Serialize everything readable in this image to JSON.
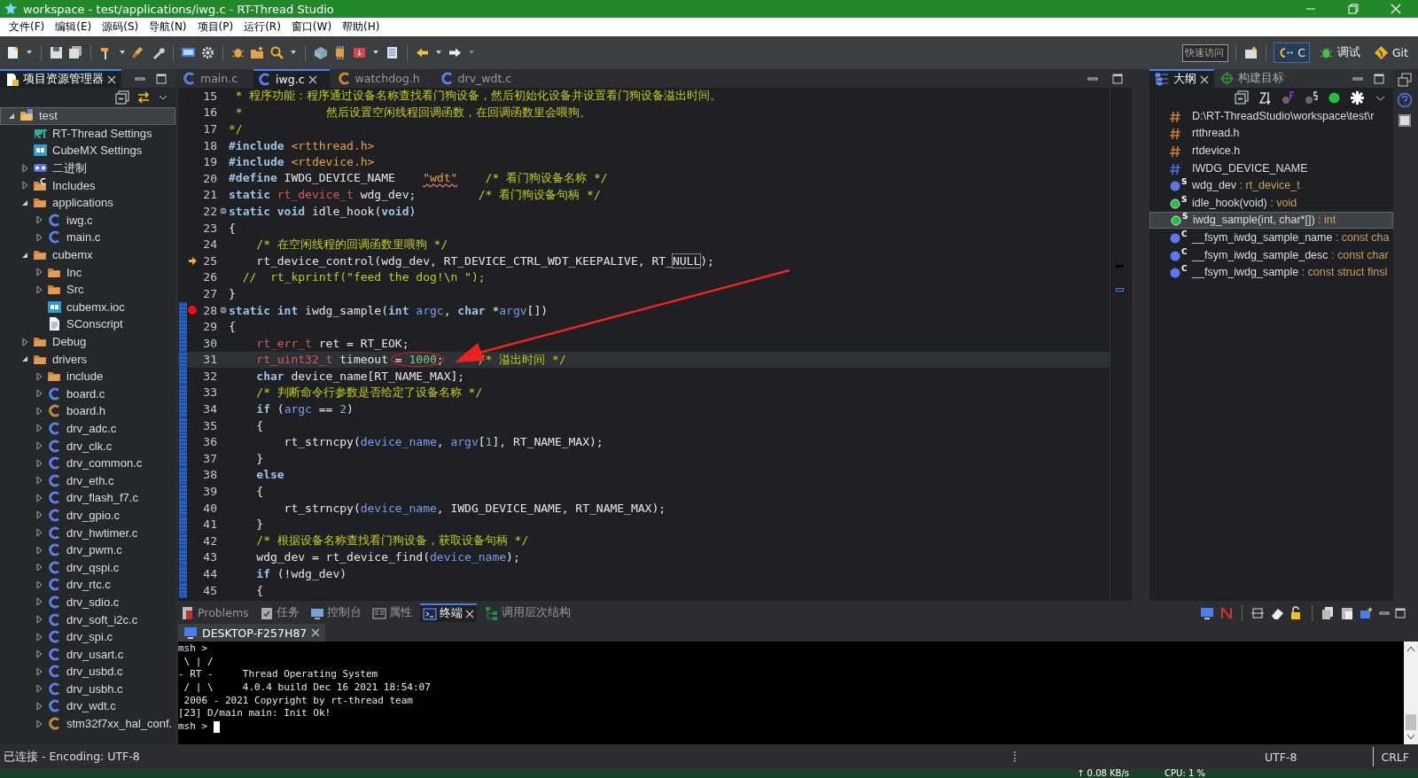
{
  "window": {
    "title": "workspace - test/applications/iwg.c - RT-Thread Studio"
  },
  "menu": [
    "文件(F)",
    "编辑(E)",
    "源码(S)",
    "导航(N)",
    "项目(P)",
    "运行(R)",
    "窗口(W)",
    "帮助(H)"
  ],
  "toolbar": {
    "quick_access": {
      "placeholder": "快速访问"
    },
    "perspectives": [
      {
        "label": "C",
        "kind": "cpp",
        "selected": true
      },
      {
        "label": "调试",
        "kind": "debug",
        "selected": false
      },
      {
        "label": "Git",
        "kind": "git",
        "selected": false
      }
    ]
  },
  "explorer": {
    "title": "项目资源管理器",
    "tree": [
      {
        "label": "test",
        "kind": "project",
        "expanded": true,
        "selected": true,
        "children": [
          {
            "label": "RT-Thread Settings",
            "kind": "rt",
            "selected": false
          },
          {
            "label": "CubeMX Settings",
            "kind": "mx",
            "selected": false
          },
          {
            "label": "二进制",
            "kind": "binary",
            "expanded": false,
            "selected": false
          },
          {
            "label": "Includes",
            "kind": "includes",
            "expanded": false,
            "selected": false
          },
          {
            "label": "applications",
            "kind": "folder",
            "expanded": true,
            "selected": false,
            "children": [
              {
                "label": "iwg.c",
                "kind": "c",
                "expanded": false,
                "selected": false
              },
              {
                "label": "main.c",
                "kind": "c",
                "expanded": false,
                "selected": false
              }
            ]
          },
          {
            "label": "cubemx",
            "kind": "folder",
            "expanded": true,
            "selected": false,
            "children": [
              {
                "label": "Inc",
                "kind": "folder",
                "expanded": false,
                "selected": false
              },
              {
                "label": "Src",
                "kind": "folder",
                "expanded": false,
                "selected": false
              },
              {
                "label": "cubemx.ioc",
                "kind": "mx",
                "selected": false
              },
              {
                "label": "SConscript",
                "kind": "file",
                "selected": false
              }
            ]
          },
          {
            "label": "Debug",
            "kind": "folder",
            "expanded": false,
            "selected": false
          },
          {
            "label": "drivers",
            "kind": "folder",
            "expanded": true,
            "selected": false,
            "children": [
              {
                "label": "include",
                "kind": "folder",
                "expanded": false,
                "selected": false
              },
              {
                "label": "board.c",
                "kind": "c",
                "expanded": false,
                "selected": false
              },
              {
                "label": "board.h",
                "kind": "h",
                "expanded": false,
                "selected": false
              },
              {
                "label": "drv_adc.c",
                "kind": "c",
                "expanded": false,
                "selected": false
              },
              {
                "label": "drv_clk.c",
                "kind": "c",
                "expanded": false,
                "selected": false
              },
              {
                "label": "drv_common.c",
                "kind": "c",
                "expanded": false,
                "selected": false
              },
              {
                "label": "drv_eth.c",
                "kind": "c",
                "expanded": false,
                "selected": false
              },
              {
                "label": "drv_flash_f7.c",
                "kind": "c",
                "expanded": false,
                "selected": false
              },
              {
                "label": "drv_gpio.c",
                "kind": "c",
                "expanded": false,
                "selected": false
              },
              {
                "label": "drv_hwtimer.c",
                "kind": "c",
                "expanded": false,
                "selected": false
              },
              {
                "label": "drv_pwm.c",
                "kind": "c",
                "expanded": false,
                "selected": false
              },
              {
                "label": "drv_qspi.c",
                "kind": "c",
                "expanded": false,
                "selected": false
              },
              {
                "label": "drv_rtc.c",
                "kind": "c",
                "expanded": false,
                "selected": false
              },
              {
                "label": "drv_sdio.c",
                "kind": "c",
                "expanded": false,
                "selected": false
              },
              {
                "label": "drv_soft_i2c.c",
                "kind": "c",
                "expanded": false,
                "selected": false
              },
              {
                "label": "drv_spi.c",
                "kind": "c",
                "expanded": false,
                "selected": false
              },
              {
                "label": "drv_usart.c",
                "kind": "c",
                "expanded": false,
                "selected": false
              },
              {
                "label": "drv_usbd.c",
                "kind": "c",
                "expanded": false,
                "selected": false
              },
              {
                "label": "drv_usbh.c",
                "kind": "c",
                "expanded": false,
                "selected": false
              },
              {
                "label": "drv_wdt.c",
                "kind": "c",
                "expanded": false,
                "selected": false
              },
              {
                "label": "stm32f7xx_hal_conf.",
                "kind": "h",
                "expanded": false,
                "selected": false
              }
            ]
          }
        ]
      }
    ]
  },
  "editor": {
    "tabs": [
      {
        "label": "main.c",
        "kind": "c",
        "selected": false
      },
      {
        "label": "iwg.c",
        "kind": "c",
        "selected": true
      },
      {
        "label": "watchdog.h",
        "kind": "h",
        "selected": false
      },
      {
        "label": "drv_wdt.c",
        "kind": "c",
        "selected": false
      }
    ],
    "lines": [
      {
        "number": "15",
        "code": [
          {
            "kind": "cm",
            "text": " * 程序功能：程序通过设备名称查找看门狗设备，然后初始化设备并设置看门狗设备溢出时间。"
          }
        ]
      },
      {
        "number": "16",
        "code": [
          {
            "kind": "cm",
            "text": " *            然后设置空闲线程回调函数，在回调函数里会喂狗。"
          }
        ]
      },
      {
        "number": "17",
        "code": [
          {
            "kind": "cm",
            "text": "*/"
          }
        ]
      },
      {
        "number": "18",
        "code": [
          {
            "kind": "kw",
            "text": "#include"
          },
          {
            "kind": "in",
            "text": " <rtthread.h>"
          }
        ]
      },
      {
        "number": "19",
        "code": [
          {
            "kind": "kw",
            "text": "#include"
          },
          {
            "kind": "in",
            "text": " <rtdevice.h>"
          }
        ]
      },
      {
        "number": "20",
        "code": [
          {
            "kind": "kw",
            "text": "#define"
          },
          {
            "kind": "p",
            "text": " IWDG_DEVICE_NAME    "
          },
          {
            "kind": "stw",
            "text": "\"wdt\""
          },
          {
            "kind": "cm",
            "text": "    /* 看门狗设备名称 */"
          }
        ]
      },
      {
        "number": "21",
        "code": [
          {
            "kind": "kw",
            "text": "static"
          },
          {
            "kind": "ty",
            "text": " rt_device_t"
          },
          {
            "kind": "p",
            "text": " wdg_dev;         "
          },
          {
            "kind": "cm",
            "text": "/* 看门狗设备句柄 */"
          }
        ]
      },
      {
        "number": "22",
        "fold": true,
        "code": [
          {
            "kind": "kw",
            "text": "static"
          },
          {
            "kind": "kw",
            "text": " void"
          },
          {
            "kind": "p",
            "text": " idle_hook("
          },
          {
            "kind": "kw",
            "text": "void"
          },
          {
            "kind": "p",
            "text": ")"
          }
        ]
      },
      {
        "number": "23",
        "code": [
          {
            "kind": "p",
            "text": "{"
          }
        ]
      },
      {
        "number": "24",
        "code": [
          {
            "kind": "cm",
            "text": "    /* 在空闲线程的回调函数里喂狗 */"
          }
        ]
      },
      {
        "number": "25",
        "instruction_pointer": true,
        "code": [
          {
            "kind": "p",
            "text": "    rt_device_control(wdg_dev, RT_DEVICE_CTRL_WDT_KEEPALIVE, RT_"
          },
          {
            "kind": "oc",
            "text": "NULL"
          },
          {
            "kind": "p",
            "text": ");"
          }
        ]
      },
      {
        "number": "26",
        "code": [
          {
            "kind": "cm",
            "text": "  //  rt_kprintf(\"feed the dog!\\n \");"
          }
        ]
      },
      {
        "number": "27",
        "code": [
          {
            "kind": "p",
            "text": "}"
          }
        ]
      },
      {
        "number": "28",
        "fold": true,
        "changed": true,
        "breakpoint": true,
        "code": [
          {
            "kind": "kw",
            "text": "static"
          },
          {
            "kind": "kw",
            "text": " int"
          },
          {
            "kind": "p",
            "text": " iwdg_sample("
          },
          {
            "kind": "kw",
            "text": "int"
          },
          {
            "kind": "pa",
            "text": " argc"
          },
          {
            "kind": "p",
            "text": ", "
          },
          {
            "kind": "kw",
            "text": "char"
          },
          {
            "kind": "p",
            "text": " *"
          },
          {
            "kind": "pa",
            "text": "argv"
          },
          {
            "kind": "p",
            "text": "[])"
          }
        ]
      },
      {
        "number": "29",
        "changed": true,
        "code": [
          {
            "kind": "p",
            "text": "{"
          }
        ]
      },
      {
        "number": "30",
        "changed": true,
        "code": [
          {
            "kind": "ty",
            "text": "    rt_err_t"
          },
          {
            "kind": "p",
            "text": " ret = RT_EOK;"
          }
        ]
      },
      {
        "number": "31",
        "current": true,
        "changed": true,
        "circled": true,
        "code": [
          {
            "kind": "ty",
            "text": "    rt_uint32_t"
          },
          {
            "kind": "p",
            "text": " timeout = "
          },
          {
            "kind": "nu",
            "text": "1000"
          },
          {
            "kind": "p",
            "text": ";     "
          },
          {
            "kind": "cm",
            "text": "/* 溢出时间 */"
          }
        ]
      },
      {
        "number": "32",
        "changed": true,
        "code": [
          {
            "kind": "kw",
            "text": "    char"
          },
          {
            "kind": "p",
            "text": " device_name[RT_NAME_MAX];"
          }
        ]
      },
      {
        "number": "33",
        "changed": true,
        "code": [
          {
            "kind": "cm",
            "text": "    /* 判断命令行参数是否给定了设备名称 */"
          }
        ]
      },
      {
        "number": "34",
        "changed": true,
        "code": [
          {
            "kind": "kw",
            "text": "    if"
          },
          {
            "kind": "p",
            "text": " ("
          },
          {
            "kind": "pa",
            "text": "argc"
          },
          {
            "kind": "p",
            "text": " == "
          },
          {
            "kind": "nu",
            "text": "2"
          },
          {
            "kind": "p",
            "text": ")"
          }
        ]
      },
      {
        "number": "35",
        "changed": true,
        "code": [
          {
            "kind": "p",
            "text": "    {"
          }
        ]
      },
      {
        "number": "36",
        "changed": true,
        "code": [
          {
            "kind": "p",
            "text": "        rt_strncpy("
          },
          {
            "kind": "pa",
            "text": "device_name"
          },
          {
            "kind": "p",
            "text": ", "
          },
          {
            "kind": "pa",
            "text": "argv"
          },
          {
            "kind": "p",
            "text": "["
          },
          {
            "kind": "nu",
            "text": "1"
          },
          {
            "kind": "p",
            "text": "], RT_NAME_MAX);"
          }
        ]
      },
      {
        "number": "37",
        "changed": true,
        "code": [
          {
            "kind": "p",
            "text": "    }"
          }
        ]
      },
      {
        "number": "38",
        "changed": true,
        "code": [
          {
            "kind": "kw",
            "text": "    else"
          }
        ]
      },
      {
        "number": "39",
        "changed": true,
        "code": [
          {
            "kind": "p",
            "text": "    {"
          }
        ]
      },
      {
        "number": "40",
        "changed": true,
        "code": [
          {
            "kind": "p",
            "text": "        rt_strncpy("
          },
          {
            "kind": "pa",
            "text": "device_name"
          },
          {
            "kind": "p",
            "text": ", IWDG_DEVICE_NAME, RT_NAME_MAX);"
          }
        ]
      },
      {
        "number": "41",
        "changed": true,
        "code": [
          {
            "kind": "p",
            "text": "    }"
          }
        ]
      },
      {
        "number": "42",
        "changed": true,
        "code": [
          {
            "kind": "cm",
            "text": "    /* 根据设备名称查找看门狗设备，获取设备句柄 */"
          }
        ]
      },
      {
        "number": "43",
        "changed": true,
        "code": [
          {
            "kind": "p",
            "text": "    wdg_dev = rt_device_find("
          },
          {
            "kind": "pa",
            "text": "device_name"
          },
          {
            "kind": "p",
            "text": ");"
          }
        ]
      },
      {
        "number": "44",
        "changed": true,
        "code": [
          {
            "kind": "kw",
            "text": "    if"
          },
          {
            "kind": "p",
            "text": " (!wdg_dev)"
          }
        ]
      },
      {
        "number": "45",
        "changed": true,
        "code": [
          {
            "kind": "p",
            "text": "    {"
          }
        ]
      }
    ]
  },
  "outline": {
    "tabs": [
      {
        "label": "大纲",
        "kind": "outline",
        "selected": true
      },
      {
        "label": "构建目标",
        "kind": "target",
        "selected": false
      }
    ],
    "items": [
      {
        "kind": "include",
        "name": "D:\\RT-ThreadStudio\\workspace\\test\\r",
        "selected": false
      },
      {
        "kind": "include",
        "name": "rtthread.h",
        "selected": false
      },
      {
        "kind": "include",
        "name": "rtdevice.h",
        "selected": false
      },
      {
        "kind": "macro",
        "name": "IWDG_DEVICE_NAME",
        "selected": false
      },
      {
        "kind": "var",
        "badge": "S",
        "name": "wdg_dev",
        "type": " : rt_device_t",
        "selected": false
      },
      {
        "kind": "func",
        "badge": "S",
        "name": "idle_hook(void)",
        "type": " : void",
        "selected": false
      },
      {
        "kind": "func",
        "badge": "S",
        "name": "iwdg_sample(int, char*[])",
        "type": " : int",
        "selected": true
      },
      {
        "kind": "var",
        "badge": "C",
        "name": "__fsym_iwdg_sample_name",
        "type": " : const cha",
        "selected": false
      },
      {
        "kind": "var",
        "badge": "C",
        "name": "__fsym_iwdg_sample_desc",
        "type": " : const char",
        "selected": false
      },
      {
        "kind": "var",
        "badge": "C",
        "name": "__fsym_iwdg_sample",
        "type": " : const struct finsl",
        "selected": false
      }
    ]
  },
  "bottom_panel": {
    "tabs": [
      {
        "label": "Problems",
        "kind": "problems",
        "selected": false
      },
      {
        "label": "任务",
        "kind": "tasks",
        "selected": false
      },
      {
        "label": "控制台",
        "kind": "console",
        "selected": false
      },
      {
        "label": "属性",
        "kind": "properties",
        "selected": false
      },
      {
        "label": "终端",
        "kind": "terminal",
        "selected": true
      },
      {
        "label": "调用层次结构",
        "kind": "hierarchy",
        "selected": false
      }
    ],
    "terminal": {
      "tab": "DESKTOP-F257H87",
      "lines": [
        "msh >",
        " \\ | /",
        "- RT -     Thread Operating System",
        " / | \\     4.0.4 build Dec 16 2021 18:54:07",
        " 2006 - 2021 Copyright by rt-thread team",
        "[23] D/main main: Init Ok!"
      ],
      "prompt": "msh >"
    }
  },
  "status_bar": {
    "left": "已连接 - Encoding: UTF-8",
    "encoding": "UTF-8",
    "line_ending": "CRLF"
  },
  "taskbar": {
    "network": "↑ 0.08 KB/s",
    "cpu": "CPU: 1 %"
  }
}
